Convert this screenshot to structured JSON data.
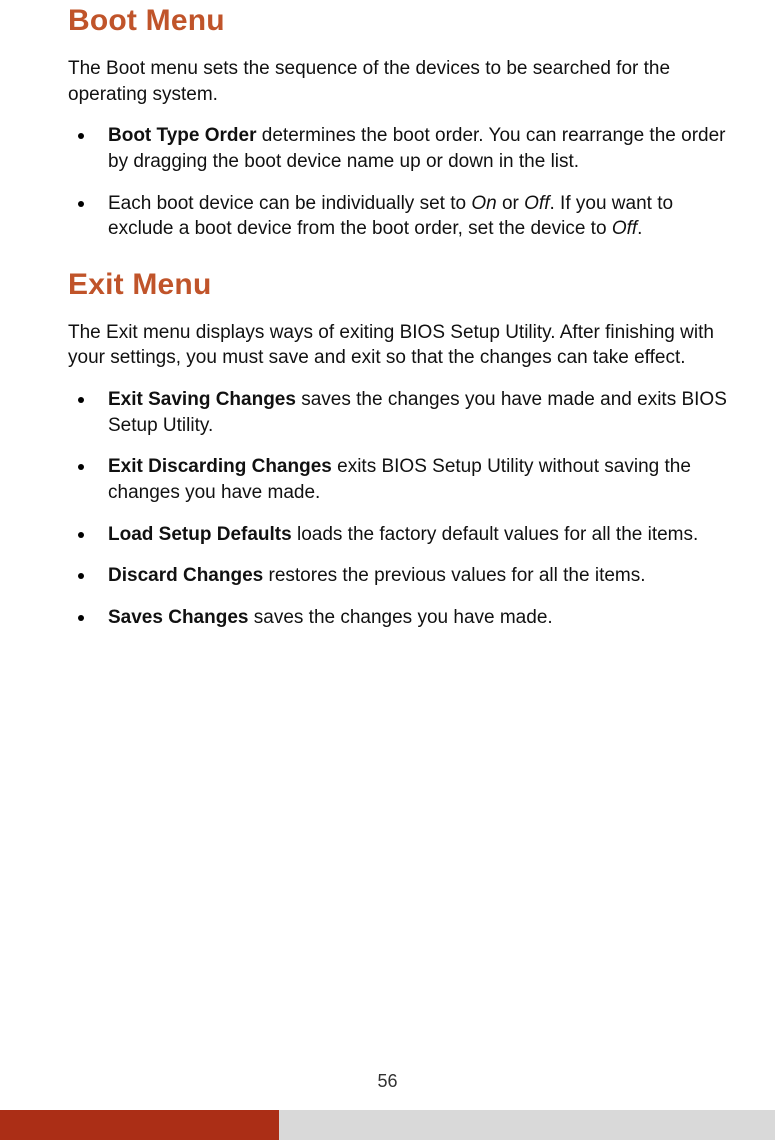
{
  "sections": [
    {
      "heading": "Boot Menu",
      "intro": "The Boot menu sets the sequence of the devices to be searched for the operating system.",
      "items": [
        {
          "runs": [
            {
              "text": "Boot Type Order",
              "bold": true
            },
            {
              "text": " determines the boot order. You can rearrange the order by dragging the boot device name up or down in the list."
            }
          ]
        },
        {
          "runs": [
            {
              "text": "Each boot device can be individually set to "
            },
            {
              "text": "On",
              "italic": true
            },
            {
              "text": " or "
            },
            {
              "text": "Off",
              "italic": true
            },
            {
              "text": ". If you want to exclude a boot device from the boot order, set the device to "
            },
            {
              "text": "Off",
              "italic": true
            },
            {
              "text": "."
            }
          ]
        }
      ]
    },
    {
      "heading": "Exit Menu",
      "intro": "The Exit menu displays ways of exiting BIOS Setup Utility. After finishing with your settings, you must save and exit so that the changes can take effect.",
      "items": [
        {
          "runs": [
            {
              "text": "Exit Saving Changes",
              "bold": true
            },
            {
              "text": " saves the changes you have made and exits BIOS Setup Utility."
            }
          ]
        },
        {
          "runs": [
            {
              "text": "Exit Discarding Changes",
              "bold": true
            },
            {
              "text": " exits BIOS Setup Utility without saving the changes you have made."
            }
          ]
        },
        {
          "runs": [
            {
              "text": "Load Setup Defaults",
              "bold": true
            },
            {
              "text": " loads the factory default values for all the items."
            }
          ]
        },
        {
          "runs": [
            {
              "text": "Discard Changes",
              "bold": true
            },
            {
              "text": " restores the previous values for all the items."
            }
          ]
        },
        {
          "runs": [
            {
              "text": "Saves Changes",
              "bold": true
            },
            {
              "text": " saves the changes you have made."
            }
          ]
        }
      ]
    }
  ],
  "page_number": "56",
  "colors": {
    "heading": "#c0542a",
    "footer_left": "#ab2e16",
    "footer_right": "#d9d9d9"
  }
}
